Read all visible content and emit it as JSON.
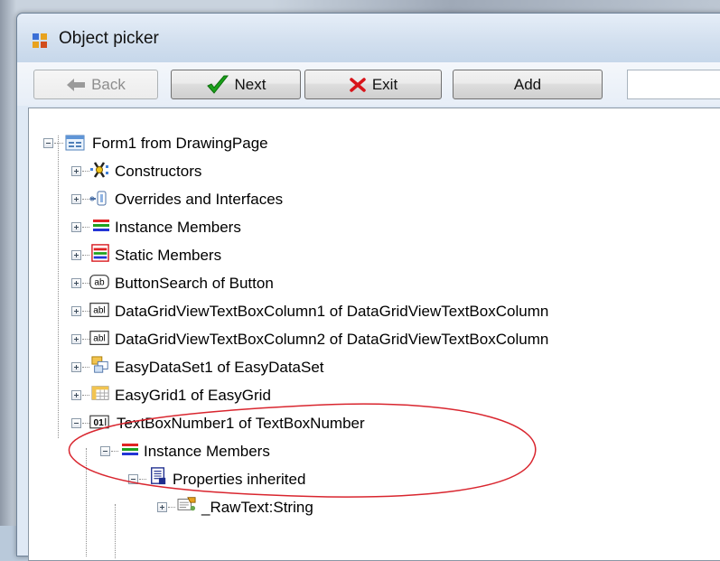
{
  "window": {
    "title": "Object picker"
  },
  "toolbar": {
    "back_label": "Back",
    "next_label": "Next",
    "exit_label": "Exit",
    "add_label": "Add",
    "search_value": ""
  },
  "tree": {
    "root": "Form1 from DrawingPage",
    "items": [
      "Constructors",
      "Overrides and Interfaces",
      "Instance Members",
      "Static Members",
      "ButtonSearch of Button",
      "DataGridViewTextBoxColumn1 of DataGridViewTextBoxColumn",
      "DataGridViewTextBoxColumn2 of DataGridViewTextBoxColumn",
      "EasyDataSet1 of EasyDataSet",
      "EasyGrid1 of EasyGrid",
      "TextBoxNumber1 of TextBoxNumber"
    ],
    "child_instance_members": "Instance Members",
    "child_properties_inherited": "Properties inherited",
    "child_rawtext": "_RawText:String"
  },
  "icons": {
    "ab_text": "ab",
    "abl_text": "abl",
    "num_text": "01"
  },
  "colors": {
    "annotation_ellipse": "#d9262f",
    "next_check": "#1aa11a",
    "exit_x": "#d8141a"
  }
}
